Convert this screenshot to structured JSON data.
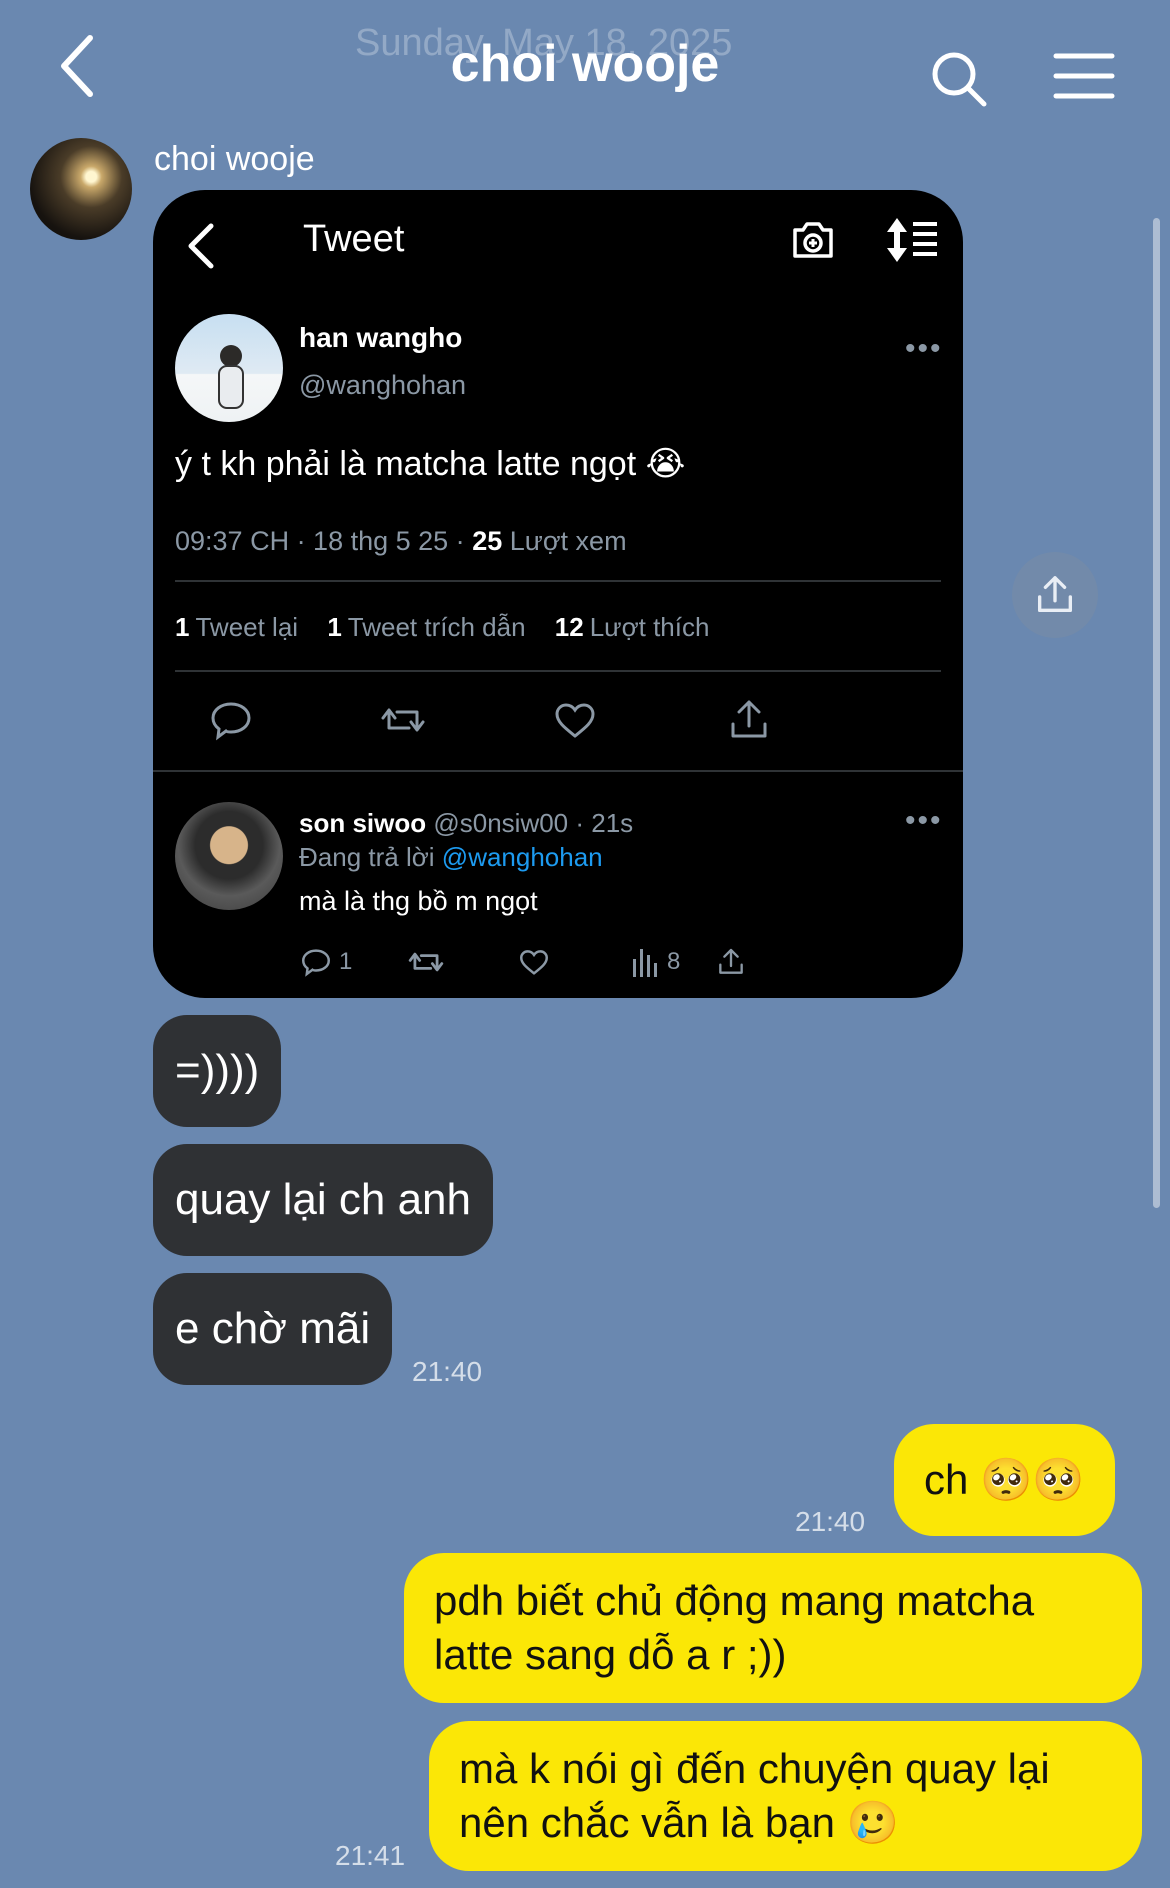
{
  "header": {
    "date_ghost": "Sunday, May 18, 2025",
    "title": "choi wooje",
    "back_icon": "chevron-left-icon",
    "search_icon": "search-icon",
    "menu_icon": "hamburger-menu-icon"
  },
  "sender": {
    "name": "choi wooje"
  },
  "tweet_image": {
    "screen_title": "Tweet",
    "author_name": "han wangho",
    "author_handle": "@wanghohan",
    "text": "ý t kh phải là matcha latte ngọt 😭",
    "meta_time": "09:37 CH · 18 thg 5 25 ·",
    "views_count": "25",
    "views_label": "Lượt xem",
    "retweets_count": "1",
    "retweets_label": "Tweet lại",
    "quotes_count": "1",
    "quotes_label": "Tweet trích dẫn",
    "likes_count": "12",
    "likes_label": "Lượt thích",
    "reply": {
      "name": "son siwoo",
      "handle_time": "@s0nsiw00 · 21s",
      "replying_prefix": "Đang trả lời",
      "replying_to": "@wanghohan",
      "text": "mà là thg bồ m ngọt",
      "reply_count": "1",
      "views_count": "8"
    }
  },
  "messages_in": [
    {
      "text": "=))))"
    },
    {
      "text": "quay lại ch anh"
    },
    {
      "text": "e chờ mãi"
    }
  ],
  "time_in": "21:40",
  "messages_out": [
    {
      "text": "ch 🥺🥺",
      "time": "21:40"
    },
    {
      "text": "pdh biết chủ động mang matcha latte sang dỗ a r ;))"
    },
    {
      "text": "mà k nói gì đến chuyện quay lại nên chắc vẫn là bạn 🥲",
      "time": "21:41"
    }
  ],
  "colors": {
    "background": "#6a88b0",
    "incoming_bubble": "#2f3134",
    "outgoing_bubble": "#fbe706"
  }
}
